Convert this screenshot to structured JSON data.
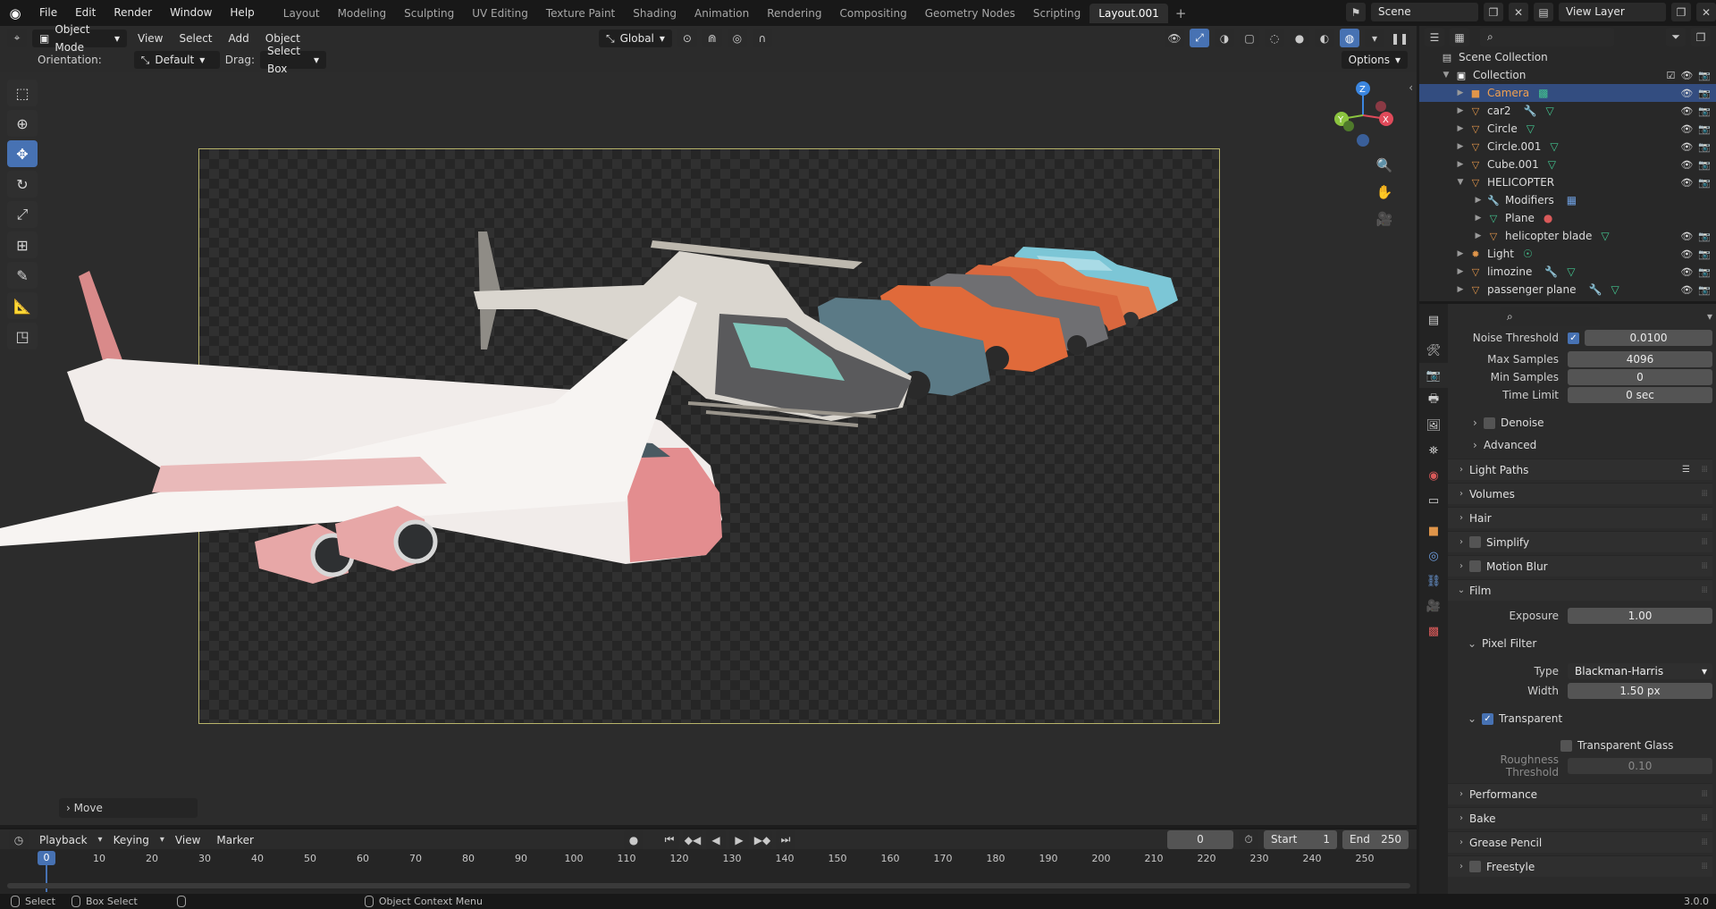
{
  "topbar": {
    "menus": [
      "File",
      "Edit",
      "Render",
      "Window",
      "Help"
    ],
    "workspaces": [
      "Layout",
      "Modeling",
      "Sculpting",
      "UV Editing",
      "Texture Paint",
      "Shading",
      "Animation",
      "Rendering",
      "Compositing",
      "Geometry Nodes",
      "Scripting",
      "Layout.001"
    ],
    "active_workspace": "Layout.001",
    "scene": "Scene",
    "view_layer": "View Layer"
  },
  "viewport_header": {
    "mode": "Object Mode",
    "menus": [
      "View",
      "Select",
      "Add",
      "Object"
    ],
    "transform_orientation": "Global",
    "orientation_label": "Orientation:",
    "orientation_value": "Default",
    "drag_label": "Drag:",
    "drag_value": "Select Box",
    "options_label": "Options"
  },
  "gizmo": {
    "z": "Z",
    "y": "Y",
    "x": "X"
  },
  "last_operator": "Move",
  "outliner": {
    "root": "Scene Collection",
    "collection": "Collection",
    "items": [
      {
        "name": "Camera",
        "type": "camera",
        "selected": true
      },
      {
        "name": "car2",
        "type": "mesh"
      },
      {
        "name": "Circle",
        "type": "mesh"
      },
      {
        "name": "Circle.001",
        "type": "mesh"
      },
      {
        "name": "Cube.001",
        "type": "mesh"
      },
      {
        "name": "HELICOPTER",
        "type": "mesh",
        "expanded": true
      },
      {
        "name": "Modifiers",
        "type": "modifiers",
        "child": true
      },
      {
        "name": "Plane",
        "type": "mesh",
        "child": true
      },
      {
        "name": "helicopter blade",
        "type": "mesh",
        "child": true
      },
      {
        "name": "Light",
        "type": "light"
      },
      {
        "name": "limozine",
        "type": "mesh"
      },
      {
        "name": "passenger plane",
        "type": "mesh"
      }
    ]
  },
  "properties": {
    "noise_threshold": {
      "label": "Noise Threshold",
      "value": "0.0100"
    },
    "max_samples": {
      "label": "Max Samples",
      "value": "4096"
    },
    "min_samples": {
      "label": "Min Samples",
      "value": "0"
    },
    "time_limit": {
      "label": "Time Limit",
      "value": "0 sec"
    },
    "denoise": "Denoise",
    "advanced": "Advanced",
    "light_paths": "Light Paths",
    "volumes": "Volumes",
    "hair": "Hair",
    "simplify": "Simplify",
    "motion_blur": "Motion Blur",
    "film": "Film",
    "exposure": {
      "label": "Exposure",
      "value": "1.00"
    },
    "pixel_filter": "Pixel Filter",
    "filter_type": {
      "label": "Type",
      "value": "Blackman-Harris"
    },
    "filter_width": {
      "label": "Width",
      "value": "1.50 px"
    },
    "transparent": "Transparent",
    "transparent_glass": "Transparent Glass",
    "roughness_threshold": {
      "label": "Roughness Threshold",
      "value": "0.10"
    },
    "performance": "Performance",
    "bake": "Bake",
    "grease_pencil": "Grease Pencil",
    "freestyle": "Freestyle"
  },
  "timeline": {
    "menus": [
      "Playback",
      "Keying",
      "View",
      "Marker"
    ],
    "current_frame": "0",
    "start_label": "Start",
    "start": "1",
    "end_label": "End",
    "end": "250",
    "ticks": [
      "0",
      "10",
      "20",
      "30",
      "40",
      "50",
      "60",
      "70",
      "80",
      "90",
      "100",
      "110",
      "120",
      "130",
      "140",
      "150",
      "160",
      "170",
      "180",
      "190",
      "200",
      "210",
      "220",
      "230",
      "240",
      "250"
    ]
  },
  "statusbar": {
    "select": "Select",
    "box_select": "Box Select",
    "context_menu": "Object Context Menu",
    "version": "3.0.0"
  }
}
